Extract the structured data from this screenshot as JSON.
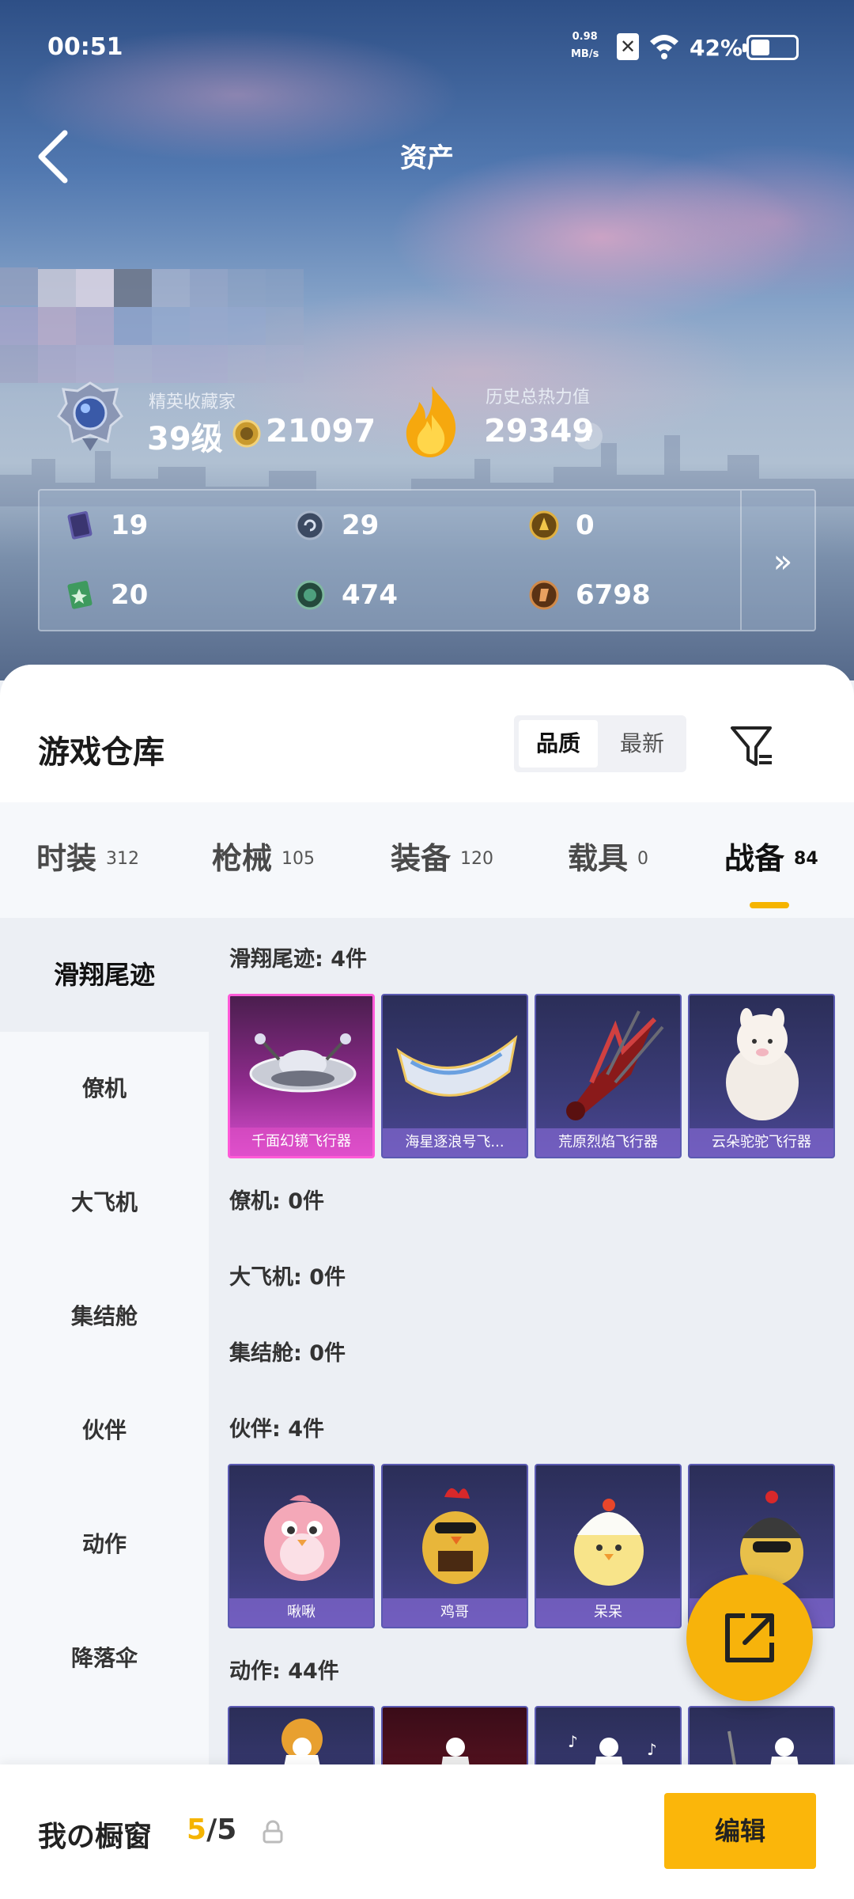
{
  "status_bar": {
    "time": "00:51",
    "net_speed_value": "0.98",
    "net_speed_unit": "MB/s",
    "sim_indicator": "✕",
    "battery_percent": "42%",
    "battery_level": 0.42
  },
  "header": {
    "title": "资产",
    "back_icon": "back-arrow-icon"
  },
  "profile": {
    "rank_label": "精英收藏家",
    "rank_level": "39级",
    "rank_points": "21097",
    "heat_label": "历史总热力值",
    "heat_value": "29349",
    "help_glyph": "?"
  },
  "currencies": [
    {
      "icon": "card-icon",
      "value": "19",
      "color": "#6b67b8"
    },
    {
      "icon": "silver-coin-icon",
      "value": "29",
      "color": "#7e8ea6"
    },
    {
      "icon": "gold-coin-icon",
      "value": "0",
      "color": "#b88a2a"
    },
    {
      "icon": "green-card-icon",
      "value": "20",
      "color": "#3e9a5e"
    },
    {
      "icon": "green-coin-icon",
      "value": "474",
      "color": "#3a7a60"
    },
    {
      "icon": "bronze-coin-icon",
      "value": "6798",
      "color": "#a8642e"
    }
  ],
  "currency_more_glyph": "»",
  "warehouse": {
    "title": "游戏仓库",
    "sort_options": [
      "品质",
      "最新"
    ],
    "sort_selected": "品质"
  },
  "tabs": [
    {
      "label": "时装",
      "count": "312"
    },
    {
      "label": "枪械",
      "count": "105"
    },
    {
      "label": "装备",
      "count": "120"
    },
    {
      "label": "载具",
      "count": "0"
    },
    {
      "label": "战备",
      "count": "84"
    }
  ],
  "active_tab": "战备",
  "sidebar": [
    {
      "label": "滑翔尾迹"
    },
    {
      "label": "僚机"
    },
    {
      "label": "大飞机"
    },
    {
      "label": "集结舱"
    },
    {
      "label": "伙伴"
    },
    {
      "label": "动作"
    },
    {
      "label": "降落伞"
    }
  ],
  "groups": [
    {
      "heading": "滑翔尾迹: 4件",
      "items": [
        "千面幻镜飞行器",
        "海星逐浪号飞...",
        "荒原烈焰飞行器",
        "云朵驼驼飞行器"
      ]
    },
    {
      "heading": "僚机: 0件",
      "items": []
    },
    {
      "heading": "大飞机: 0件",
      "items": []
    },
    {
      "heading": "集结舱: 0件",
      "items": []
    },
    {
      "heading": "伙伴: 4件",
      "items": [
        "啾啾",
        "鸡哥",
        "呆呆",
        ""
      ]
    },
    {
      "heading": "动作: 44件",
      "items": [
        "",
        "",
        "",
        ""
      ]
    }
  ],
  "footer": {
    "title": "我の橱窗",
    "count_current": "5",
    "count_sep_total": "/5",
    "edit_label": "编辑"
  },
  "colors": {
    "accent": "#f5b400",
    "card_pink": "#d84fcf",
    "card_purple": "#4b4694"
  }
}
